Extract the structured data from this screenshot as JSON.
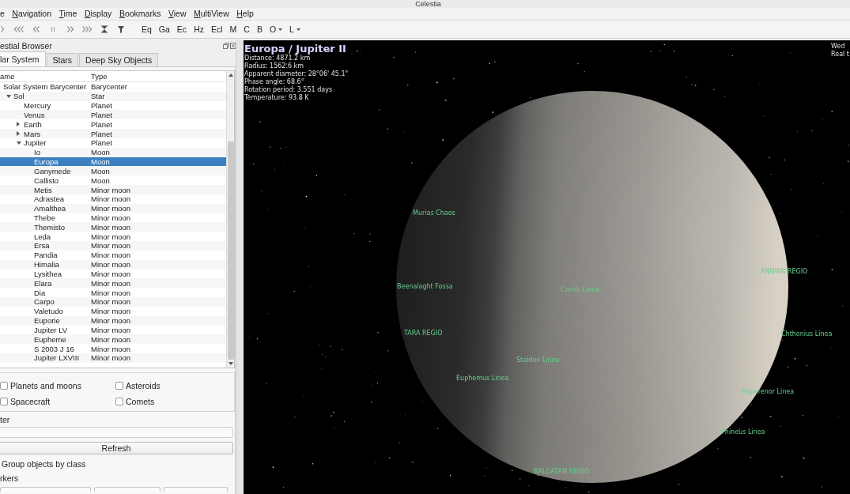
{
  "window": {
    "title": "Celestia"
  },
  "menu": [
    {
      "label": "e",
      "underlined": false
    },
    {
      "label": "Navigation",
      "underlined": true
    },
    {
      "label": "Time",
      "underlined": true
    },
    {
      "label": "Display",
      "underlined": true
    },
    {
      "label": "Bookmarks",
      "underlined": true
    },
    {
      "label": "View",
      "underlined": true
    },
    {
      "label": "MultiView",
      "underlined": true
    },
    {
      "label": "Help",
      "underlined": true
    }
  ],
  "toolbar": {
    "buttons": [
      {
        "label": "Eq",
        "kind": "button"
      },
      {
        "label": "Ga",
        "kind": "button"
      },
      {
        "label": "Ec",
        "kind": "button"
      },
      {
        "label": "Hz",
        "kind": "button"
      },
      {
        "label": "Ecl",
        "kind": "button"
      },
      {
        "label": "M",
        "kind": "button"
      },
      {
        "label": "C",
        "kind": "button"
      },
      {
        "label": "B",
        "kind": "button"
      },
      {
        "label": "O",
        "kind": "dropdown"
      },
      {
        "label": "L",
        "kind": "dropdown"
      }
    ]
  },
  "browser": {
    "title": "estial Browser",
    "tabs": [
      {
        "label": "lar System",
        "selected": true
      },
      {
        "label": "Stars",
        "selected": false
      },
      {
        "label": "Deep Sky Objects",
        "selected": false
      }
    ],
    "columns": [
      "ame",
      "Type"
    ],
    "tree": [
      {
        "name": "Solar System Barycenter",
        "type": "Barycenter",
        "selected": false,
        "children": [
          {
            "name": "Sol",
            "type": "Star",
            "selected": false,
            "expanded": true,
            "children": [
              {
                "name": "Mercury",
                "type": "Planet",
                "selected": false
              },
              {
                "name": "Venus",
                "type": "Planet",
                "selected": false
              },
              {
                "name": "Earth",
                "type": "Planet",
                "selected": false,
                "expanded": false
              },
              {
                "name": "Mars",
                "type": "Planet",
                "selected": false,
                "expanded": false
              },
              {
                "name": "Jupiter",
                "type": "Planet",
                "selected": false,
                "expanded": true,
                "children": [
                  {
                    "name": "Io",
                    "type": "Moon",
                    "selected": false
                  },
                  {
                    "name": "Europa",
                    "type": "Moon",
                    "selected": true
                  },
                  {
                    "name": "Ganymede",
                    "type": "Moon",
                    "selected": false
                  },
                  {
                    "name": "Callisto",
                    "type": "Moon",
                    "selected": false
                  },
                  {
                    "name": "Metis",
                    "type": "Minor moon",
                    "selected": false
                  },
                  {
                    "name": "Adrastea",
                    "type": "Minor moon",
                    "selected": false
                  },
                  {
                    "name": "Amalthea",
                    "type": "Minor moon",
                    "selected": false
                  },
                  {
                    "name": "Thebe",
                    "type": "Minor moon",
                    "selected": false
                  },
                  {
                    "name": "Themisto",
                    "type": "Minor moon",
                    "selected": false
                  },
                  {
                    "name": "Leda",
                    "type": "Minor moon",
                    "selected": false
                  },
                  {
                    "name": "Ersa",
                    "type": "Minor moon",
                    "selected": false
                  },
                  {
                    "name": "Pandia",
                    "type": "Minor moon",
                    "selected": false
                  },
                  {
                    "name": "Himalia",
                    "type": "Minor moon",
                    "selected": false
                  },
                  {
                    "name": "Lysithea",
                    "type": "Minor moon",
                    "selected": false
                  },
                  {
                    "name": "Elara",
                    "type": "Minor moon",
                    "selected": false
                  },
                  {
                    "name": "Dia",
                    "type": "Minor moon",
                    "selected": false
                  },
                  {
                    "name": "Carpo",
                    "type": "Minor moon",
                    "selected": false
                  },
                  {
                    "name": "Valetudo",
                    "type": "Minor moon",
                    "selected": false
                  },
                  {
                    "name": "Euporie",
                    "type": "Minor moon",
                    "selected": false
                  },
                  {
                    "name": "Jupiter LV",
                    "type": "Minor moon",
                    "selected": false
                  },
                  {
                    "name": "Eupheme",
                    "type": "Minor moon",
                    "selected": false
                  },
                  {
                    "name": "S 2003 J 16",
                    "type": "Minor moon",
                    "selected": false
                  },
                  {
                    "name": "Jupiter LXVIII",
                    "type": "Minor moon",
                    "selected": false
                  }
                ]
              }
            ]
          }
        ]
      }
    ],
    "filters": [
      {
        "label": "Planets and moons",
        "checked": false
      },
      {
        "label": "Asteroids",
        "checked": false
      },
      {
        "label": "Spacecraft",
        "checked": false
      },
      {
        "label": "Comets",
        "checked": false
      }
    ],
    "filter_label": "ter",
    "refresh_button": "Refresh",
    "group_option": "Group objects by class",
    "markers_label": "rkers"
  },
  "view": {
    "title": "Europa / Jupiter II",
    "details": [
      "Distance: 4871.2 km",
      "Radius: 1562.6 km",
      "Apparent diameter: 28°06' 45.1\"",
      "Phase angle: 68.6°",
      "Rotation period: 3.551 days",
      "Temperature: 93.8 K"
    ],
    "corner_lines": [
      "Wed",
      "Real t"
    ],
    "surface_labels": [
      "Murias Chaos",
      "Beenalaght Fossa",
      "Corick Linea",
      "ANNWN REGIO",
      "TARA REGIO",
      "Chthonius Linea",
      "Staldon Linea",
      "Euphemus Linea",
      "Hyperenor Linea",
      "Phineus Linea",
      "BALGATAN REGIO"
    ]
  }
}
